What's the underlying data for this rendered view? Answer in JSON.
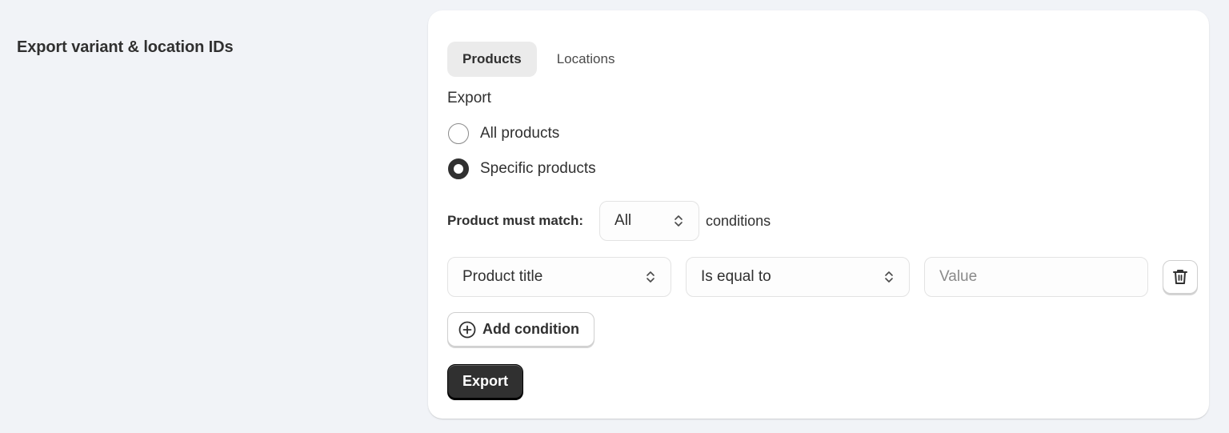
{
  "section": {
    "title": "Export variant & location IDs"
  },
  "tabs": [
    {
      "label": "Products",
      "active": true
    },
    {
      "label": "Locations",
      "active": false
    }
  ],
  "export": {
    "label": "Export",
    "options": [
      {
        "label": "All products",
        "checked": false
      },
      {
        "label": "Specific products",
        "checked": true
      }
    ]
  },
  "match": {
    "label": "Product must match:",
    "value": "All",
    "suffix": "conditions"
  },
  "condition": {
    "field": "Product title",
    "operator": "Is equal to",
    "value": "",
    "value_placeholder": "Value",
    "delete_icon": "trash-icon"
  },
  "add_condition": {
    "label": "Add condition",
    "icon": "plus-circle-icon"
  },
  "submit": {
    "label": "Export"
  },
  "colors": {
    "primary_button": "#303030",
    "background": "#f1f3f7",
    "card": "#ffffff"
  }
}
